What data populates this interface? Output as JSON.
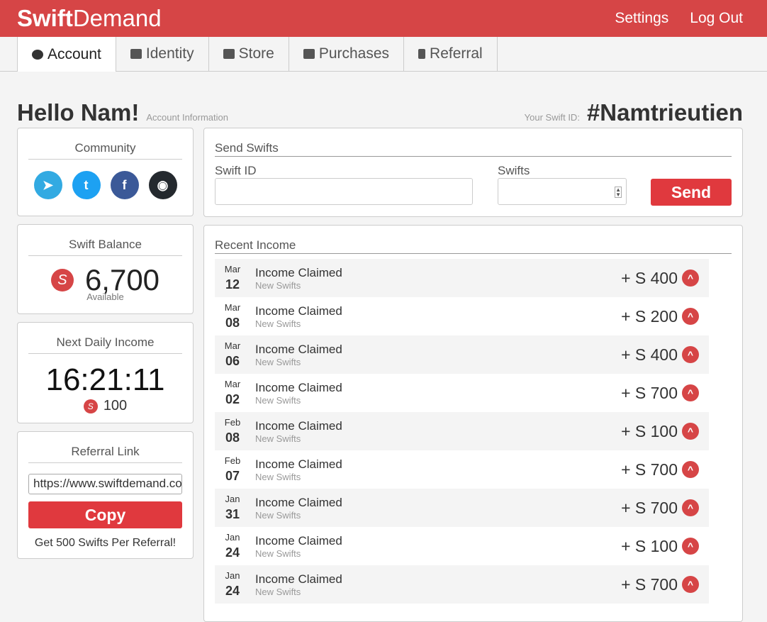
{
  "brand": {
    "bold": "Swift",
    "light": "Demand"
  },
  "nav": {
    "settings": "Settings",
    "logout": "Log Out"
  },
  "tabs": [
    "Account",
    "Identity",
    "Store",
    "Purchases",
    "Referral"
  ],
  "greeting": "Hello Nam!",
  "account_info": "Account Information",
  "swift_id_label": "Your Swift ID:",
  "swift_id": "#Namtrieutien",
  "community": {
    "title": "Community"
  },
  "balance": {
    "title": "Swift Balance",
    "value": "6,700",
    "sub": "Available",
    "symbol": "S"
  },
  "daily": {
    "title": "Next Daily Income",
    "timer": "16:21:11",
    "amount": "100"
  },
  "referral": {
    "title": "Referral Link",
    "link": "https://www.swiftdemand.com",
    "copy": "Copy",
    "note": "Get 500 Swifts Per Referral!"
  },
  "send": {
    "title": "Send Swifts",
    "id_label": "Swift ID",
    "swifts_label": "Swifts",
    "button": "Send"
  },
  "income": {
    "title": "Recent Income",
    "rows": [
      {
        "m": "Mar",
        "d": "12",
        "t": "Income Claimed",
        "s": "New Swifts",
        "a": "+ S 400"
      },
      {
        "m": "Mar",
        "d": "08",
        "t": "Income Claimed",
        "s": "New Swifts",
        "a": "+ S 200"
      },
      {
        "m": "Mar",
        "d": "06",
        "t": "Income Claimed",
        "s": "New Swifts",
        "a": "+ S 400"
      },
      {
        "m": "Mar",
        "d": "02",
        "t": "Income Claimed",
        "s": "New Swifts",
        "a": "+ S 700"
      },
      {
        "m": "Feb",
        "d": "08",
        "t": "Income Claimed",
        "s": "New Swifts",
        "a": "+ S 100"
      },
      {
        "m": "Feb",
        "d": "07",
        "t": "Income Claimed",
        "s": "New Swifts",
        "a": "+ S 700"
      },
      {
        "m": "Jan",
        "d": "31",
        "t": "Income Claimed",
        "s": "New Swifts",
        "a": "+ S 700"
      },
      {
        "m": "Jan",
        "d": "24",
        "t": "Income Claimed",
        "s": "New Swifts",
        "a": "+ S 100"
      },
      {
        "m": "Jan",
        "d": "24",
        "t": "Income Claimed",
        "s": "New Swifts",
        "a": "+ S 700"
      }
    ]
  }
}
